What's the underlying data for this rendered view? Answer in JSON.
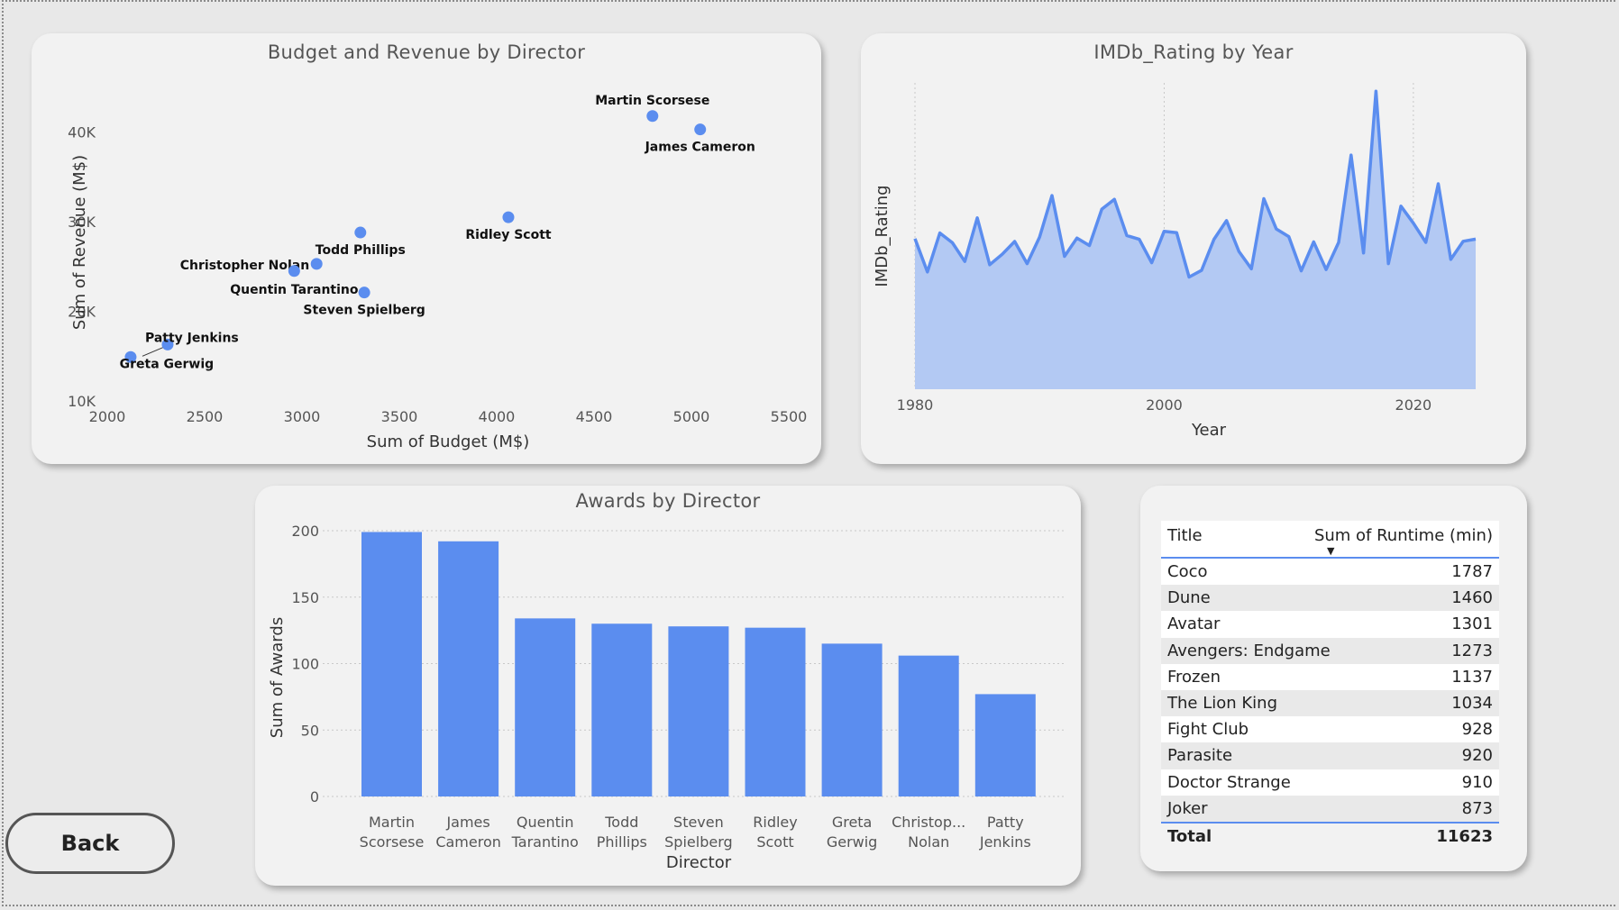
{
  "scatter": {
    "title": "Budget and Revenue by Director",
    "xlabel": "Sum of Budget (M$)",
    "ylabel": "Sum of Revenue (M$)"
  },
  "line": {
    "title": "IMDb_Rating by Year",
    "xlabel": "Year",
    "ylabel": "IMDb_Rating"
  },
  "bar": {
    "title": "Awards by Director",
    "xlabel": "Director",
    "ylabel": "Sum of Awards"
  },
  "table": {
    "col_title": "Title",
    "col_runtime": "Sum of Runtime (min)",
    "sort_indicator": "▼",
    "rows": [
      {
        "title": "Coco",
        "runtime": "1787"
      },
      {
        "title": "Dune",
        "runtime": "1460"
      },
      {
        "title": "Avatar",
        "runtime": "1301"
      },
      {
        "title": "Avengers: Endgame",
        "runtime": "1273"
      },
      {
        "title": "Frozen",
        "runtime": "1137"
      },
      {
        "title": "The Lion King",
        "runtime": "1034"
      },
      {
        "title": "Fight Club",
        "runtime": "928"
      },
      {
        "title": "Parasite",
        "runtime": "920"
      },
      {
        "title": "Doctor Strange",
        "runtime": "910"
      },
      {
        "title": "Joker",
        "runtime": "873"
      }
    ],
    "total_label": "Total",
    "total_value": "11623"
  },
  "back_button": {
    "label": "Back"
  },
  "colors": {
    "accent": "#5b8def",
    "area_fill": "#b3c9f3",
    "card": "#f2f2f2",
    "background": "#e8e8e8"
  },
  "chart_data": [
    {
      "type": "scatter",
      "title": "Budget and Revenue by Director",
      "xlabel": "Sum of Budget (M$)",
      "ylabel": "Sum of Revenue (M$)",
      "xlim": [
        2000,
        5500
      ],
      "ylim": [
        10000,
        46000
      ],
      "x_ticks": [
        2000,
        2500,
        3000,
        3500,
        4000,
        4500,
        5000,
        5500
      ],
      "x_tick_labels": [
        "2000",
        "2500",
        "3000",
        "3500",
        "4000",
        "4500",
        "5000",
        "5500"
      ],
      "y_ticks": [
        10000,
        20000,
        30000,
        40000
      ],
      "y_tick_labels": [
        "10K",
        "20K",
        "30K",
        "40K"
      ],
      "points": [
        {
          "label": "Martin Scorsese",
          "x": 4800,
          "y": 41800,
          "label_pos": "above"
        },
        {
          "label": "James Cameron",
          "x": 5045,
          "y": 40300,
          "label_pos": "below"
        },
        {
          "label": "Ridley Scott",
          "x": 4060,
          "y": 30500,
          "label_pos": "below"
        },
        {
          "label": "Todd Phillips",
          "x": 3300,
          "y": 28800,
          "label_pos": "below"
        },
        {
          "label": "Christopher Nolan",
          "x": 3075,
          "y": 25300,
          "label_pos": "left"
        },
        {
          "label": "Quentin Tarantino",
          "x": 2960,
          "y": 24500,
          "label_pos": "below-left"
        },
        {
          "label": "Steven Spielberg",
          "x": 3320,
          "y": 22100,
          "label_pos": "below"
        },
        {
          "label": "Patty Jenkins",
          "x": 2310,
          "y": 16300,
          "label_pos": "right-up"
        },
        {
          "label": "Greta Gerwig",
          "x": 2120,
          "y": 14900,
          "label_pos": "below"
        }
      ],
      "grid": false
    },
    {
      "type": "area",
      "title": "IMDb_Rating by Year",
      "xlabel": "Year",
      "ylabel": "IMDb_Rating",
      "xlim": [
        1980,
        2025
      ],
      "x_ticks": [
        1980,
        2000,
        2020
      ],
      "y_axis_labels": "none",
      "ylim": [
        0,
        10
      ],
      "x": [
        1980,
        1981,
        1982,
        1983,
        1984,
        1985,
        1986,
        1987,
        1988,
        1989,
        1990,
        1991,
        1992,
        1993,
        1994,
        1995,
        1996,
        1997,
        1998,
        1999,
        2000,
        2001,
        2002,
        2003,
        2004,
        2005,
        2006,
        2007,
        2008,
        2009,
        2010,
        2011,
        2012,
        2013,
        2014,
        2015,
        2016,
        2017,
        2018,
        2019,
        2020,
        2021,
        2022,
        2023,
        2024,
        2025
      ],
      "y": [
        7.07,
        5.51,
        7.34,
        6.88,
        6.0,
        8.05,
        5.85,
        6.34,
        6.94,
        5.9,
        7.14,
        9.1,
        6.24,
        7.1,
        6.75,
        8.46,
        8.92,
        7.22,
        7.04,
        5.94,
        7.42,
        7.35,
        5.27,
        5.58,
        7.04,
        7.92,
        6.47,
        5.66,
        8.95,
        7.53,
        7.17,
        5.56,
        6.92,
        5.62,
        6.9,
        11.0,
        6.4,
        14.0,
        5.9,
        8.6,
        7.8,
        6.9,
        9.65,
        6.1,
        6.95,
        7.05
      ],
      "grid": "vertical dotted"
    },
    {
      "type": "bar",
      "title": "Awards by Director",
      "xlabel": "Director",
      "ylabel": "Sum of Awards",
      "ylim": [
        0,
        200
      ],
      "y_ticks": [
        0,
        50,
        100,
        150,
        200
      ],
      "categories": [
        "Martin Scorsese",
        "James Cameron",
        "Quentin Tarantino",
        "Todd Phillips",
        "Steven Spielberg",
        "Ridley Scott",
        "Greta Gerwig",
        "Christop... Nolan",
        "Patty Jenkins"
      ],
      "category_labels": [
        [
          "Martin",
          "Scorsese"
        ],
        [
          "James",
          "Cameron"
        ],
        [
          "Quentin",
          "Tarantino"
        ],
        [
          "Todd",
          "Phillips"
        ],
        [
          "Steven",
          "Spielberg"
        ],
        [
          "Ridley",
          "Scott"
        ],
        [
          "Greta",
          "Gerwig"
        ],
        [
          "Christop...",
          "Nolan"
        ],
        [
          "Patty",
          "Jenkins"
        ]
      ],
      "values": [
        199,
        192,
        134,
        130,
        128,
        127,
        115,
        106,
        77
      ],
      "grid": "horizontal dotted"
    }
  ]
}
